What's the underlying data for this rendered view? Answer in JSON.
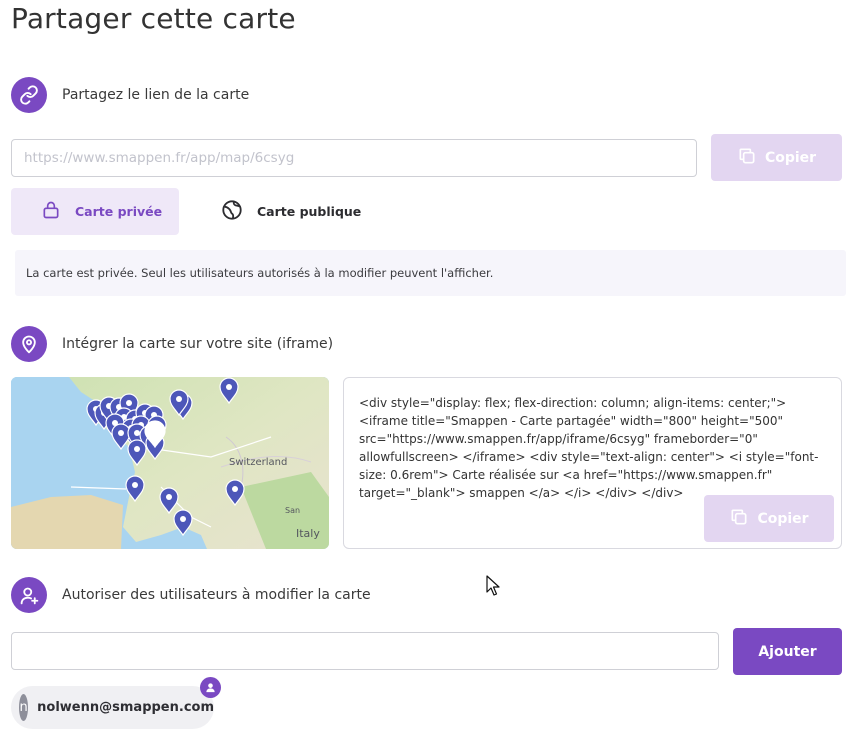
{
  "page": {
    "title": "Partager cette carte"
  },
  "share_link": {
    "label": "Partagez le lien de la carte",
    "url_placeholder": "https://www.smappen.fr/app/map/6csyg",
    "copy_label": "Copier"
  },
  "privacy": {
    "private_label": "Carte privée",
    "public_label": "Carte publique",
    "selected": "private",
    "notice": "La carte est privée. Seul les utilisateurs autorisés à la modifier peuvent l'afficher."
  },
  "embed": {
    "label": "Intégrer la carte sur votre site (iframe)",
    "code": "<div style=\"display: flex; flex-direction: column; align-items: center;\"> <iframe title=\"Smappen - Carte partagée\" width=\"800\" height=\"500\" src=\"https://www.smappen.fr/app/iframe/6csyg\" frameborder=\"0\" allowfullscreen> </iframe> <div style=\"text-align: center\"> <i style=\"font-size: 0.6rem\"> Carte réalisée sur <a href=\"https://www.smappen.fr\" target=\"_blank\"> smappen </a> </i> </div> </div>",
    "copy_label": "Copier",
    "map_labels": {
      "country1": "Switzerland",
      "country2": "Italy",
      "region": "San Marino"
    }
  },
  "users": {
    "label": "Autoriser des utilisateurs à modifier la carte",
    "input_value": "",
    "add_label": "Ajouter",
    "list": [
      {
        "initial": "n",
        "email": "nolwenn@smappen.com"
      }
    ]
  },
  "colors": {
    "accent": "#7a49c2",
    "accent_light": "#efe8f8",
    "copy_disabled": "#e3d6f1",
    "marker": "#4d57b9"
  },
  "icons": {
    "link": "link-icon",
    "pin": "map-pin-icon",
    "add_user": "user-plus-icon",
    "lock": "lock-icon",
    "globe": "globe-icon",
    "copy": "copy-icon"
  }
}
